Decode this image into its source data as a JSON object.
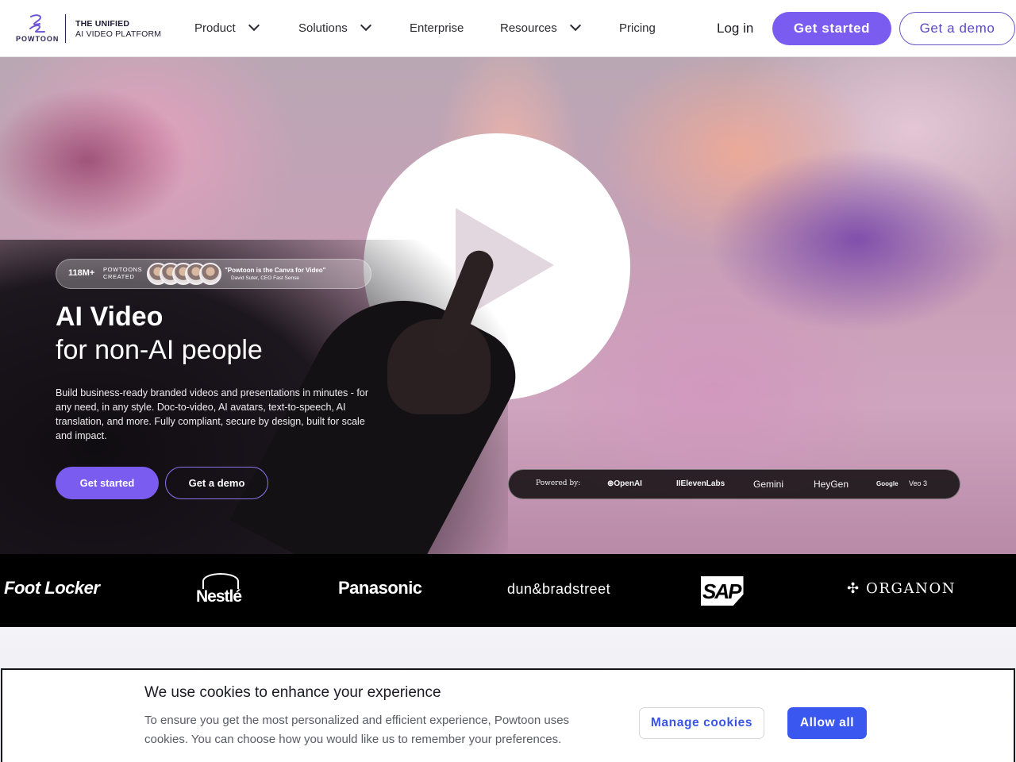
{
  "header": {
    "logo_text": "POWTOON",
    "tagline_line1": "THE UNIFIED",
    "tagline_line2": "AI VIDEO PLATFORM",
    "nav": [
      {
        "label": "Product",
        "has_dropdown": true,
        "icon": "chevron-down-icon"
      },
      {
        "label": "Solutions",
        "has_dropdown": true,
        "icon": "chevron-down-icon"
      },
      {
        "label": "Enterprise",
        "has_dropdown": false
      },
      {
        "label": "Resources",
        "has_dropdown": true,
        "icon": "chevron-down-icon"
      },
      {
        "label": "Pricing",
        "has_dropdown": false
      }
    ],
    "login_label": "Log in",
    "get_started_label": "Get started",
    "get_demo_label": "Get a demo"
  },
  "hero": {
    "social_proof": {
      "count": "118M+",
      "count_label_line1": "POWTOONS",
      "count_label_line2": "CREATED",
      "quote": "\"Powtoon is the Canva for Video\"",
      "quote_author": "David Suter, CEO Fast Sense"
    },
    "headline_bold": "AI Video",
    "headline_regular": "for non-AI people",
    "description": "Build business-ready branded videos and presentations in minutes - for any need, in any style. Doc-to-video, AI avatars, text-to-speech, AI translation, and more. Fully compliant, secure by design, built for scale and impact.",
    "get_started_label": "Get started",
    "get_demo_label": "Get a demo",
    "play_icon": "play-icon",
    "powered_by": {
      "label": "Powered by:",
      "partners": [
        "OpenAI",
        "IIElevenLabs",
        "Gemini",
        "HeyGen",
        "Google",
        "Veo 3"
      ]
    }
  },
  "customer_logos": [
    "Foot Locker",
    "Nestlé",
    "Panasonic",
    "dun&bradstreet",
    "SAP",
    "ORGANON"
  ],
  "cookie_banner": {
    "title": "We use cookies to enhance your experience",
    "text": "To ensure you get the most personalized and efficient experience, Powtoon uses cookies. You can choose how you would like us to remember your preferences.",
    "manage_label": "Manage cookies",
    "allow_label": "Allow all"
  },
  "colors": {
    "brand_purple": "#7b5cf0",
    "cookie_blue": "#3a57f0",
    "logo_strip": "#000000"
  }
}
